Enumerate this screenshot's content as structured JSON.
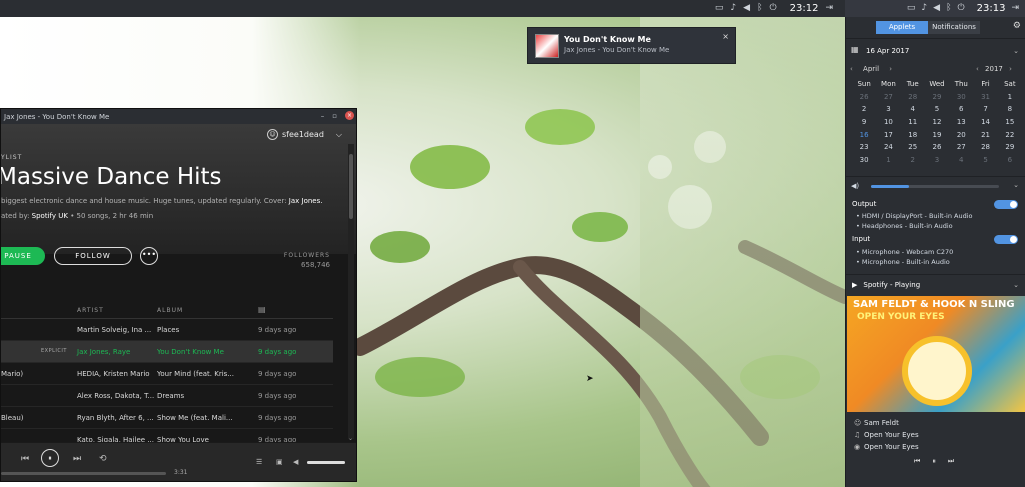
{
  "top_panel": {
    "clock": "23:12",
    "icons": [
      "screen-icon",
      "bell-icon",
      "volume-icon",
      "bluetooth-icon",
      "power-icon"
    ]
  },
  "right_panel": {
    "clock": "23:13"
  },
  "notification": {
    "title": "You Don't Know Me",
    "body": "Jax Jones - You Don't Know Me",
    "close": "×"
  },
  "spotify": {
    "window_title": "Jax Jones - You Don't Know Me",
    "controls": {
      "minimize": "–",
      "maximize": "▫",
      "close": "×"
    },
    "username": "sfee1dead",
    "header": {
      "label": "YLIST",
      "title": "Massive Dance Hits",
      "description": "biggest electronic dance and house music. Huge tunes, updated regularly. Cover: ",
      "description_link": "Jax Jones.",
      "meta_prefix": "ated by: ",
      "meta_owner": "Spotify UK",
      "meta_suffix": " • 50 songs, 2 hr 46 min"
    },
    "buttons": {
      "pause": "PAUSE",
      "follow": "FOLLOW",
      "more": "•••"
    },
    "followers": {
      "label": "FOLLOWERS",
      "count": "658,746"
    },
    "table": {
      "headers": {
        "artist": "ARTIST",
        "album": "ALBUM",
        "date_icon": "calendar-icon"
      },
      "rows": [
        {
          "title": "",
          "explicit": "",
          "artist": "Martin Solveig, Ina ...",
          "album": "Places",
          "date": "9 days ago"
        },
        {
          "title": "",
          "explicit": "EXPLICIT",
          "artist": "Jax Jones, Raye",
          "album": "You Don't Know Me",
          "date": "9 days ago",
          "active": true
        },
        {
          "title": "Mario)",
          "explicit": "",
          "artist": "HEDIA, Kristen Mario",
          "album": "Your Mind (feat. Kris...",
          "date": "9 days ago"
        },
        {
          "title": "",
          "explicit": "",
          "artist": "Alex Ross, Dakota, T...",
          "album": "Dreams",
          "date": "9 days ago"
        },
        {
          "title": "Bleau)",
          "explicit": "",
          "artist": "Ryan Blyth, After 6, ...",
          "album": "Show Me (feat. Mali...",
          "date": "9 days ago"
        },
        {
          "title": "",
          "explicit": "",
          "artist": "Kato, Sigala, Hailee ...",
          "album": "Show You Love",
          "date": "9 days ago"
        }
      ]
    },
    "player": {
      "prev": "⏮",
      "play": "⏸",
      "next": "⏭",
      "repeat": "⟲",
      "duration": "3:31",
      "progress": 0.0,
      "volume": 1.0
    }
  },
  "applets": {
    "tabs": [
      "Applets",
      "Notifications"
    ],
    "calendar": {
      "date": "16 Apr 2017",
      "month": "April",
      "year": "2017",
      "days_of_week": [
        "Sun",
        "Mon",
        "Tue",
        "Wed",
        "Thu",
        "Fri",
        "Sat"
      ],
      "weeks": [
        [
          "26",
          "27",
          "28",
          "29",
          "30",
          "31",
          "1"
        ],
        [
          "2",
          "3",
          "4",
          "5",
          "6",
          "7",
          "8"
        ],
        [
          "9",
          "10",
          "11",
          "12",
          "13",
          "14",
          "15"
        ],
        [
          "16",
          "17",
          "18",
          "19",
          "20",
          "21",
          "22"
        ],
        [
          "23",
          "24",
          "25",
          "26",
          "27",
          "28",
          "29"
        ],
        [
          "30",
          "1",
          "2",
          "3",
          "4",
          "5",
          "6"
        ]
      ]
    },
    "sound": {
      "volume": 0.3,
      "output_label": "Output",
      "outputs": [
        "HDMI / DisplayPort - Built-in Audio",
        "Headphones - Built-in Audio"
      ],
      "input_label": "Input",
      "inputs": [
        "Microphone - Webcam C270",
        "Microphone - Built-in Audio"
      ]
    },
    "spotify": {
      "status": "Spotify - Playing",
      "art_line1": "SAM FELDT & HOOK N SLING",
      "art_line2": "OPEN YOUR EYES",
      "artist": "Sam Feldt",
      "title": "Open Your Eyes",
      "album": "Open Your Eyes"
    }
  },
  "colors": {
    "accent": "#5294e2",
    "spotify_green": "#1db954",
    "panel": "#2b2e33"
  }
}
